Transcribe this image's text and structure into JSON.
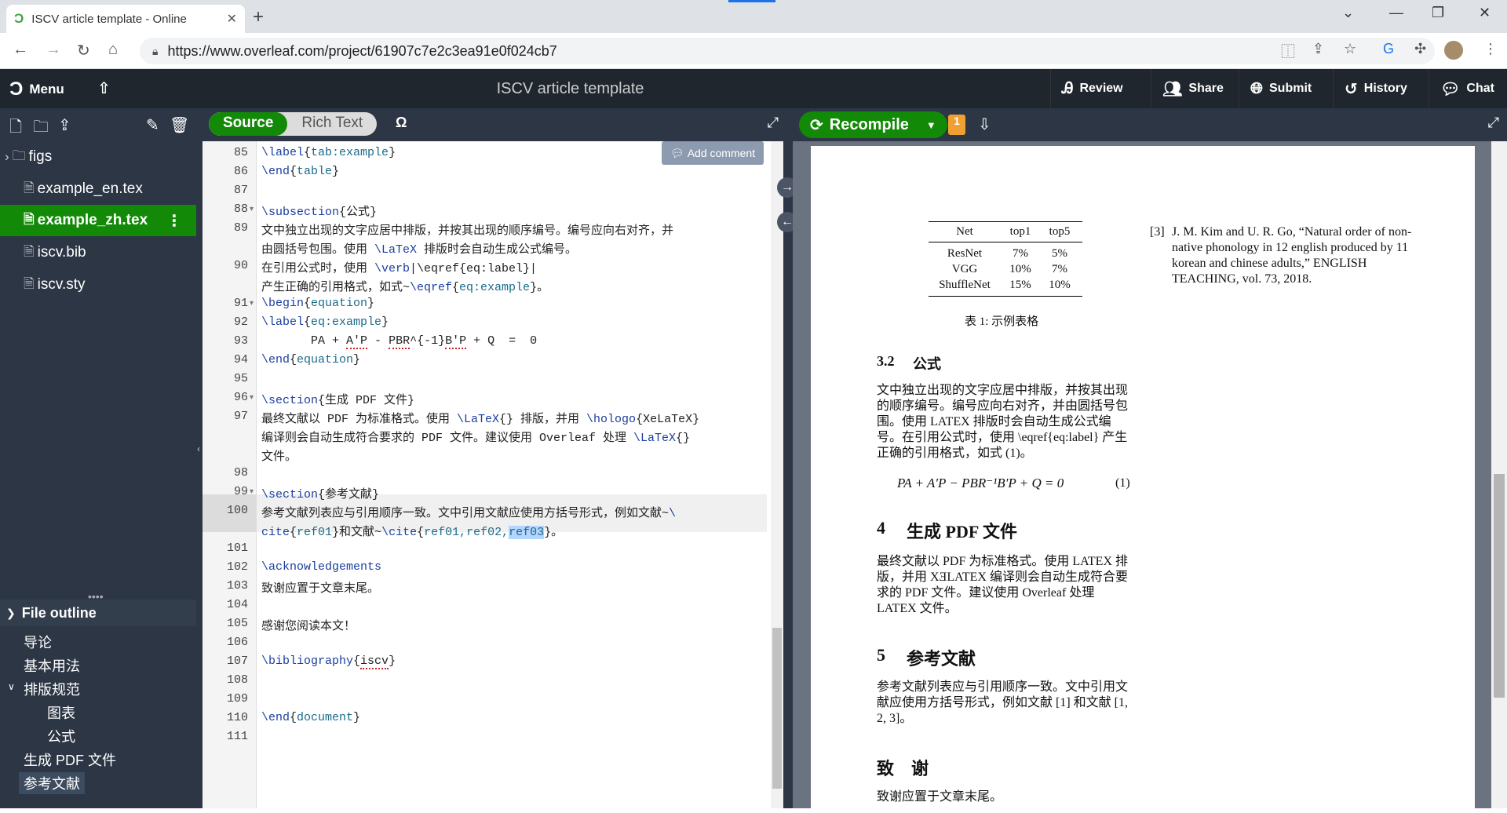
{
  "browser": {
    "tab_title": "ISCV article template - Online",
    "url": "https://www.overleaf.com/project/61907c7e2c3ea91e0f024cb7"
  },
  "header": {
    "menu_label": "Menu",
    "project_title": "ISCV article template",
    "buttons": {
      "review": "Review",
      "share": "Share",
      "submit": "Submit",
      "history": "History",
      "chat": "Chat"
    }
  },
  "file_tree": [
    {
      "name": "figs",
      "type": "folder"
    },
    {
      "name": "example_en.tex",
      "type": "file"
    },
    {
      "name": "example_zh.tex",
      "type": "file",
      "selected": true
    },
    {
      "name": "iscv.bib",
      "type": "file"
    },
    {
      "name": "iscv.sty",
      "type": "file"
    }
  ],
  "outline": {
    "title": "File outline",
    "items": [
      "导论",
      "基本用法",
      "排版规范",
      "图表",
      "公式",
      "生成 PDF 文件",
      "参考文献"
    ]
  },
  "editor": {
    "source_label": "Source",
    "rich_text_label": "Rich Text",
    "omega": "Ω",
    "add_comment": "Add comment",
    "line_numbers": [
      "85",
      "86",
      "87",
      "88",
      "89",
      "",
      "90",
      "",
      "91",
      "92",
      "93",
      "94",
      "95",
      "96",
      "97",
      "",
      "",
      "98",
      "99",
      "100",
      "",
      "101",
      "102",
      "103",
      "104",
      "105",
      "106",
      "107",
      "108",
      "109",
      "110",
      "111"
    ]
  },
  "pdf": {
    "recompile_label": "Recompile",
    "logs_count": "1",
    "table": {
      "headers": [
        "Net",
        "top1",
        "top5"
      ],
      "rows": [
        [
          "ResNet",
          "7%",
          "5%"
        ],
        [
          "VGG",
          "10%",
          "7%"
        ],
        [
          "ShuffleNet",
          "15%",
          "10%"
        ]
      ],
      "caption": "表 1: 示例表格"
    },
    "sec32_num": "3.2",
    "sec32_title": "公式",
    "sec32_text": "文中独立出现的文字应居中排版，并按其出现的顺序编号。编号应向右对齐，并由圆括号包围。使用 LATEX 排版时会自动生成公式编号。在引用公式时，使用 \\eqref{eq:label} 产生正确的引用格式，如式 (1)。",
    "equation": "PA + A′P − PBR⁻¹B′P + Q = 0",
    "eq_num": "(1)",
    "sec4_num": "4",
    "sec4_title": "生成 PDF 文件",
    "sec4_text": "最终文献以 PDF 为标准格式。使用 LATEX 排版，并用 XƎLATEX 编译则会自动生成符合要求的 PDF 文件。建议使用 Overleaf 处理 LATEX 文件。",
    "sec5_num": "5",
    "sec5_title": "参考文献",
    "sec5_text": "参考文献列表应与引用顺序一致。文中引用文献应使用方括号形式，例如文献 [1] 和文献 [1, 2, 3]。",
    "ack_title": "致　谢",
    "ack_text": "致谢应置于文章末尾。",
    "ref3_label": "[3]",
    "ref3_text": "J. M. Kim and U. R. Go, “Natural order of non-native phonology in 12 english produced by 11 korean and chinese adults,” ENGLISH TEACHING, vol. 73, 2018."
  },
  "colors": {
    "accent_green": "#138a07",
    "dark_bg": "#1f262e",
    "panel_bg": "#2c3645"
  }
}
